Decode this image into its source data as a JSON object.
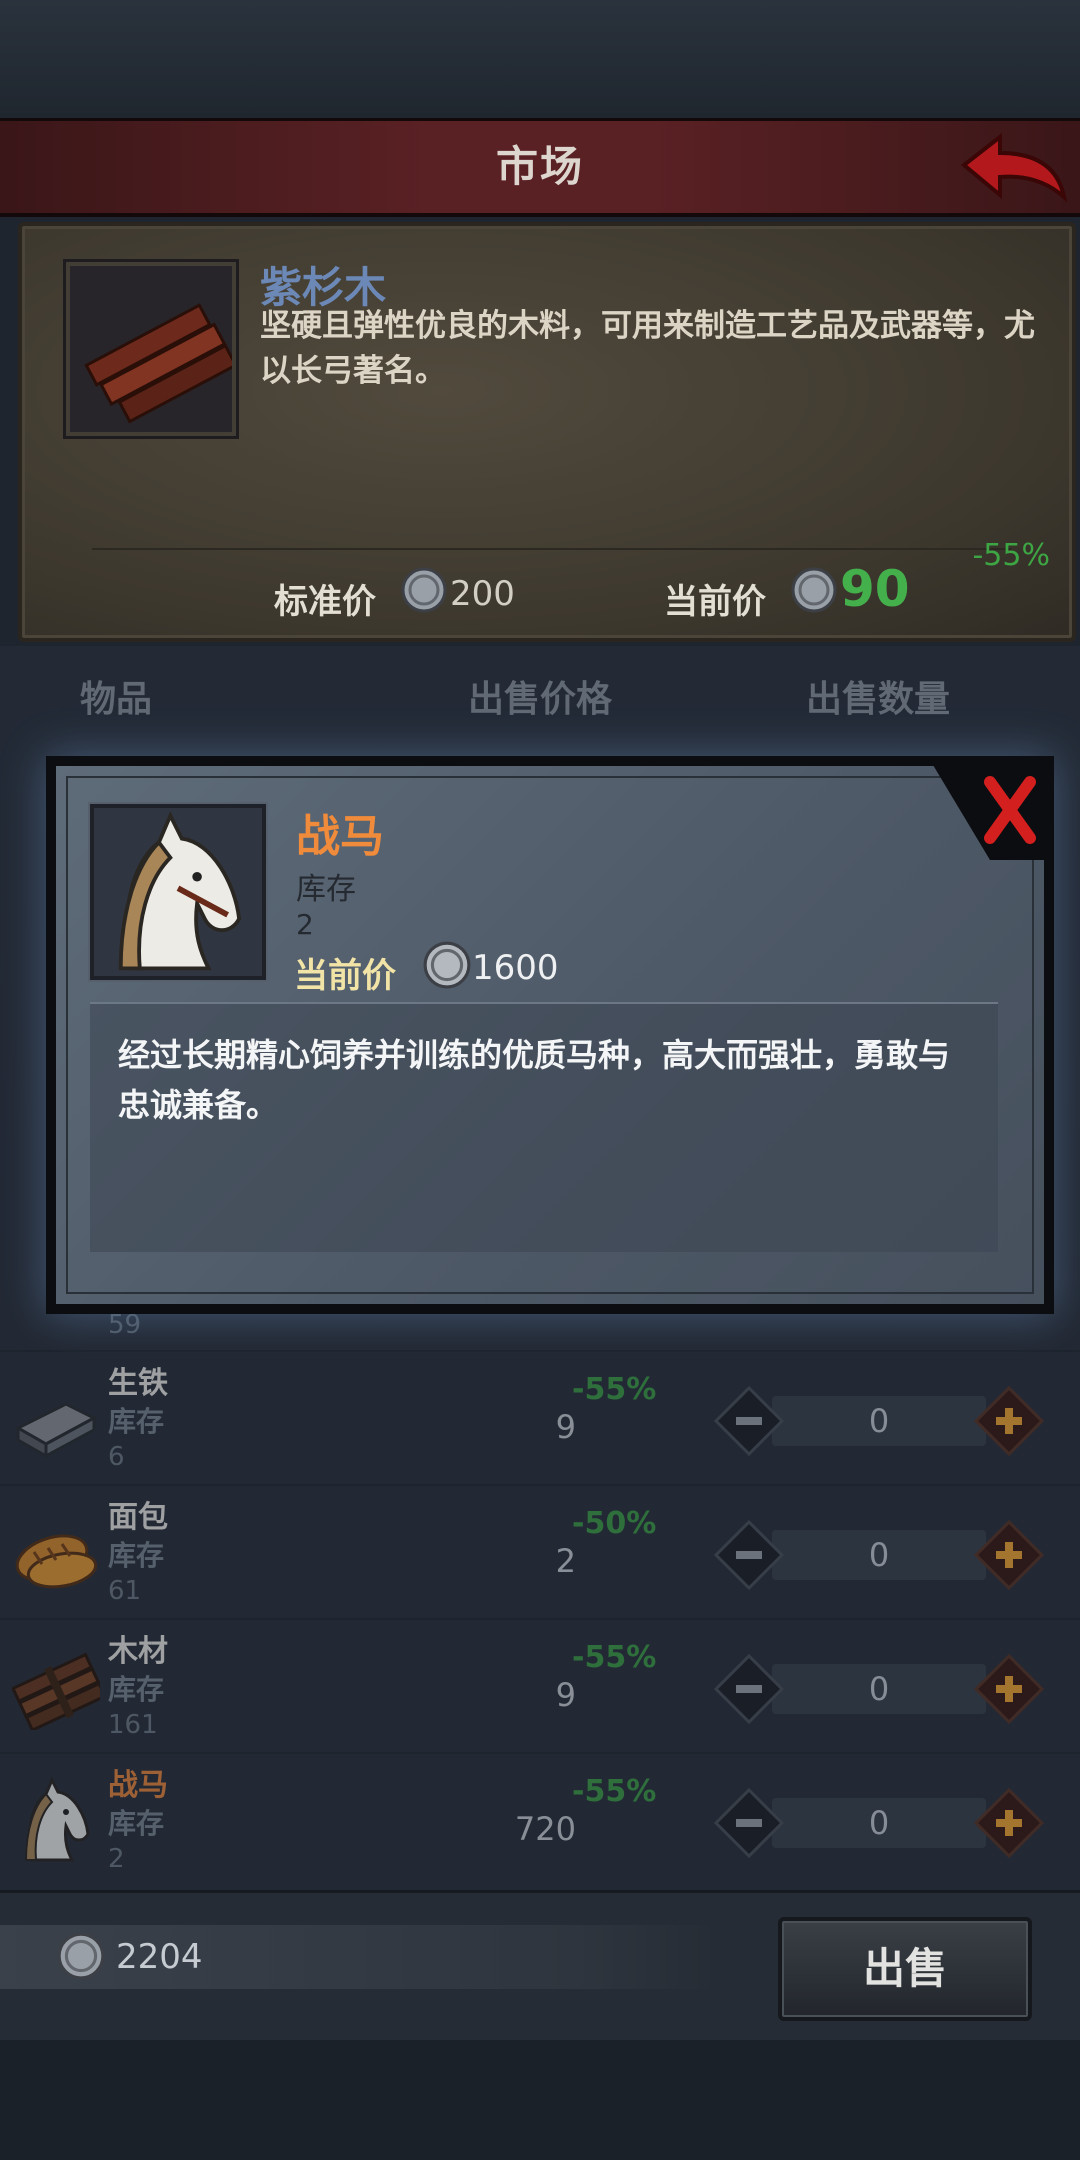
{
  "header": {
    "title": "市场"
  },
  "detail": {
    "name": "紫杉木",
    "description": "坚硬且弹性优良的木料，可用来制造工艺品及武器等，尤以长弓著名。",
    "discount": "-55%",
    "standard_price_label": "标准价",
    "standard_price": "200",
    "current_price_label": "当前价",
    "current_price": "90"
  },
  "columns": {
    "item": "物品",
    "price": "出售价格",
    "quantity": "出售数量"
  },
  "rows": [
    {
      "name": "生铁",
      "stock_label": "库存",
      "stock": "6",
      "discount": "-55%",
      "price": "9",
      "qty": "0"
    },
    {
      "name": "面包",
      "stock_label": "库存",
      "stock": "61",
      "discount": "-50%",
      "price": "2",
      "qty": "0"
    },
    {
      "name": "木材",
      "stock_label": "库存",
      "stock": "161",
      "discount": "-55%",
      "price": "9",
      "qty": "0"
    },
    {
      "name": "战马",
      "stock_label": "库存",
      "stock": "2",
      "discount": "-55%",
      "price": "720",
      "qty": "0"
    }
  ],
  "partial_row": {
    "stock": "59"
  },
  "footer": {
    "money": "2204",
    "sell_label": "出售"
  },
  "popup": {
    "name": "战马",
    "stock_label": "库存",
    "stock": "2",
    "price_label": "当前价",
    "price": "1600",
    "description": "经过长期精心饲养并训练的优质马种，高大而强壮，勇敢与忠诚兼备。"
  },
  "colors": {
    "accent_orange": "#f08b3b",
    "discount_green": "#3da544",
    "header_red": "#5a2124"
  },
  "icons": [
    "back-arrow-icon",
    "yew-wood-icon",
    "coin-icon",
    "iron-icon",
    "bread-icon",
    "timber-icon",
    "warhorse-icon",
    "minus-icon",
    "plus-icon",
    "close-icon"
  ]
}
